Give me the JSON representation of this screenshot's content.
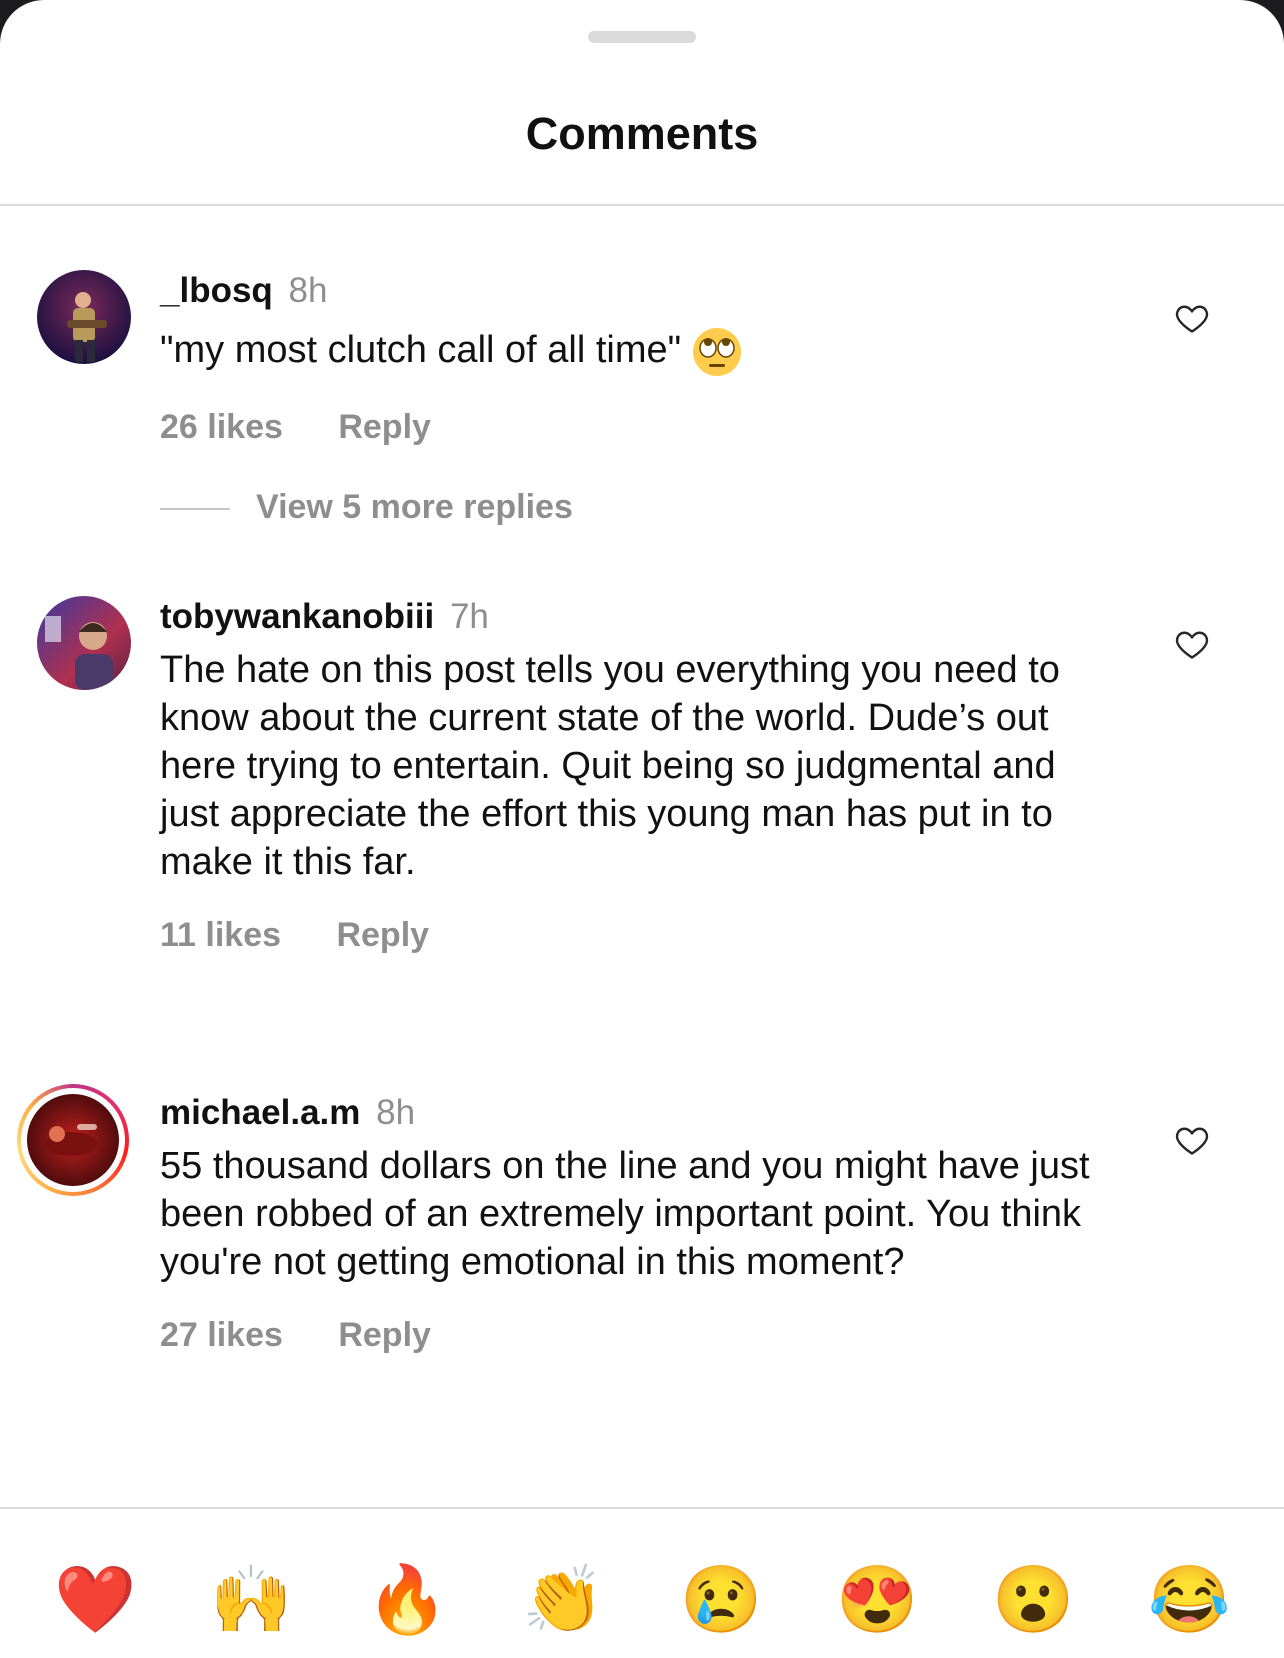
{
  "sheet": {
    "title": "Comments"
  },
  "comments": [
    {
      "username": "_lbosq",
      "time": "8h",
      "text": "\"my most clutch call of all time\"",
      "likes": "26 likes",
      "reply": "Reply",
      "emoji": "face-with-rolling-eyes"
    },
    {
      "username": "tobywankanobiii",
      "time": "7h",
      "text": "The hate on this post tells you everything you need to know about the current state of the world. Dude’s out here trying to entertain. Quit being so judgmental and just appreciate the effort this young man has put in to make it this far.",
      "likes": "11 likes",
      "reply": "Reply"
    },
    {
      "username": "michael.a.m",
      "time": "8h",
      "text": "55 thousand dollars on the line and you might have just been robbed of an extremely important point. You think you're not getting emotional in this moment?",
      "likes": "27 likes",
      "reply": "Reply"
    }
  ],
  "view_replies": "View 5 more replies",
  "reactions": [
    {
      "name": "red-heart",
      "glyph": "❤️"
    },
    {
      "name": "raising-hands",
      "glyph": "🙌"
    },
    {
      "name": "fire",
      "glyph": "🔥"
    },
    {
      "name": "clapping-hands",
      "glyph": "👏"
    },
    {
      "name": "crying-face",
      "glyph": "😢"
    },
    {
      "name": "heart-eyes",
      "glyph": "😍"
    },
    {
      "name": "face-with-open-mouth",
      "glyph": "😮"
    },
    {
      "name": "tears-of-joy",
      "glyph": "😂"
    }
  ],
  "colors": {
    "text": "#111111",
    "muted": "#8e8e8e",
    "divider": "#dbdbdb"
  }
}
